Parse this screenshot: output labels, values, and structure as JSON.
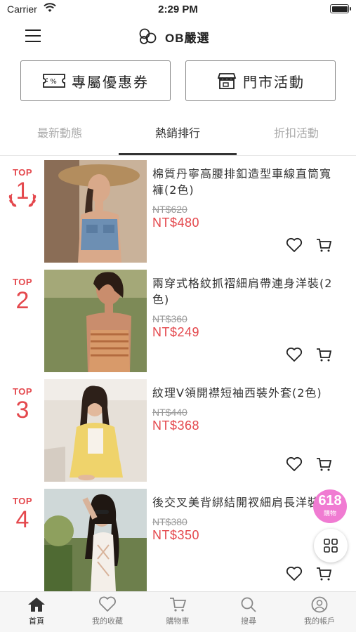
{
  "status_bar": {
    "carrier": "Carrier",
    "time": "2:29 PM"
  },
  "header": {
    "brand": "OB嚴選"
  },
  "promo_buttons": {
    "coupon": "專屬優惠券",
    "store": "門市活動"
  },
  "tabs": [
    {
      "label": "最新動態"
    },
    {
      "label": "熱銷排行"
    },
    {
      "label": "折扣活動"
    }
  ],
  "products": [
    {
      "rank_label": "TOP",
      "rank": "1",
      "title": "棉質丹寧高腰排釦造型車線直筒寬褲(2色)",
      "old_price": "NT$620",
      "price": "NT$480"
    },
    {
      "rank_label": "TOP",
      "rank": "2",
      "title": "兩穿式格紋抓褶細肩帶連身洋裝(2色)",
      "old_price": "NT$360",
      "price": "NT$249"
    },
    {
      "rank_label": "TOP",
      "rank": "3",
      "title": "紋理V領開襟短袖西裝外套(2色)",
      "old_price": "NT$440",
      "price": "NT$368"
    },
    {
      "rank_label": "TOP",
      "rank": "4",
      "title": "後交叉美背綁結開衩細肩長洋裝",
      "old_price": "NT$380",
      "price": "NT$350"
    }
  ],
  "floating": {
    "badge_number": "618",
    "badge_label": "購物"
  },
  "bottom_nav": [
    {
      "label": "首頁"
    },
    {
      "label": "我的收藏"
    },
    {
      "label": "購物車"
    },
    {
      "label": "搜尋"
    },
    {
      "label": "我的帳戶"
    }
  ],
  "colors": {
    "accent": "#e4484d",
    "badge": "#f07bd2"
  }
}
